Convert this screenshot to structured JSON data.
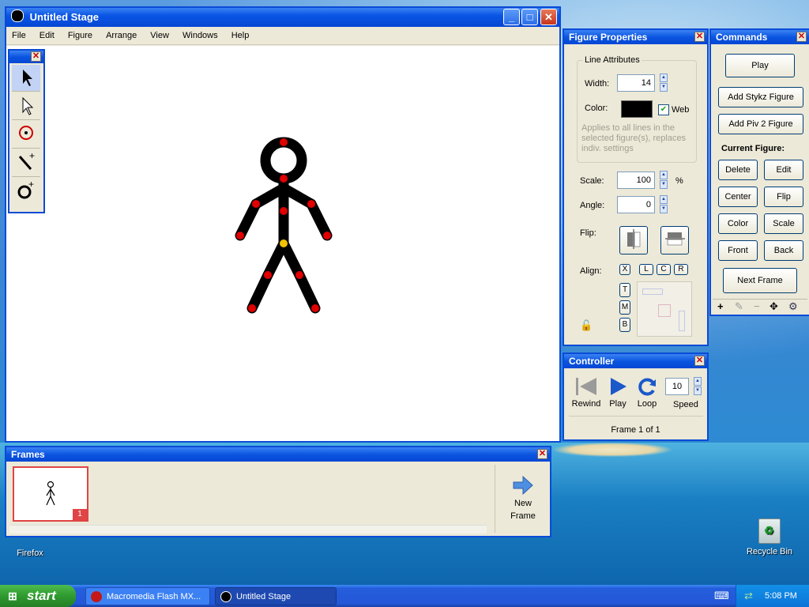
{
  "stage": {
    "title": "Untitled Stage",
    "menu": [
      "File",
      "Edit",
      "Figure",
      "Arrange",
      "View",
      "Windows",
      "Help"
    ]
  },
  "figure_properties": {
    "title": "Figure Properties",
    "line_attributes_label": "Line Attributes",
    "width_label": "Width:",
    "width_value": "14",
    "color_label": "Color:",
    "web_label": "Web",
    "web_checked": true,
    "hint": "Applies to all lines in the selected figure(s), replaces indiv. settings",
    "scale_label": "Scale:",
    "scale_value": "100",
    "scale_unit": "%",
    "angle_label": "Angle:",
    "angle_value": "0",
    "flip_label": "Flip:",
    "align_label": "Align:",
    "align_h": [
      "X",
      "L",
      "C",
      "R"
    ],
    "align_v": [
      "T",
      "M",
      "B"
    ]
  },
  "commands": {
    "title": "Commands",
    "play": "Play",
    "add_stykz": "Add Stykz Figure",
    "add_piv2": "Add Piv 2 Figure",
    "current_figure_label": "Current Figure:",
    "delete": "Delete",
    "edit": "Edit",
    "center": "Center",
    "flip": "Flip",
    "color": "Color",
    "scale": "Scale",
    "front": "Front",
    "back": "Back",
    "next_frame": "Next Frame"
  },
  "controller": {
    "title": "Controller",
    "rewind": "Rewind",
    "play": "Play",
    "loop": "Loop",
    "speed_label": "Speed",
    "speed_value": "10",
    "frame_status": "Frame 1 of 1"
  },
  "frames": {
    "title": "Frames",
    "frame_number": "1",
    "new_frame_line1": "New",
    "new_frame_line2": "Frame"
  },
  "desktop": {
    "firefox_label": "Firefox",
    "recycle_label": "Recycle Bin"
  },
  "taskbar": {
    "start_label": "start",
    "task1": "Macromedia Flash MX...",
    "task2": "Untitled Stage",
    "clock": "5:08 PM"
  },
  "colors": {
    "joint_red": "#e00000",
    "joint_yellow": "#f2c200",
    "xp_blue": "#0a4bd6"
  }
}
